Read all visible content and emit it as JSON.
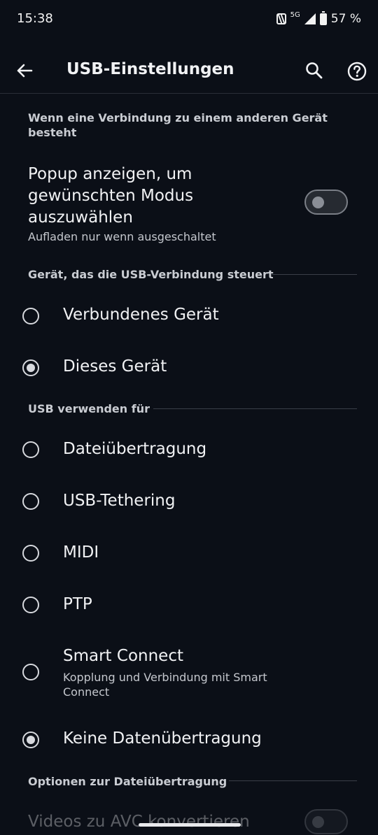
{
  "status": {
    "time": "15:38",
    "network": "5G",
    "battery": "57 %"
  },
  "appbar": {
    "title": "USB-Einstellungen"
  },
  "connection_section": {
    "header": "Wenn eine Verbindung zu einem anderen Gerät besteht",
    "popup_title": "Popup anzeigen, um gewünschten Modus auszuwählen",
    "popup_subtitle": "Aufladen nur wenn ausgeschaltet",
    "popup_enabled": false
  },
  "control_section": {
    "header": "Gerät, das die USB-Verbindung steuert",
    "options": [
      {
        "label": "Verbundenes Gerät",
        "selected": false
      },
      {
        "label": "Dieses Gerät",
        "selected": true
      }
    ]
  },
  "usage_section": {
    "header": "USB verwenden für",
    "options": [
      {
        "label": "Dateiübertragung",
        "selected": false
      },
      {
        "label": "USB-Tethering",
        "selected": false
      },
      {
        "label": "MIDI",
        "selected": false
      },
      {
        "label": "PTP",
        "selected": false
      },
      {
        "label": "Smart Connect",
        "subtitle": "Kopplung und Verbindung mit Smart Connect",
        "selected": false
      },
      {
        "label": "Keine Datenübertragung",
        "selected": true
      }
    ]
  },
  "transfer_section": {
    "header": "Optionen zur Dateiübertragung",
    "convert_title": "Videos zu AVC konvertieren",
    "convert_enabled": false
  }
}
